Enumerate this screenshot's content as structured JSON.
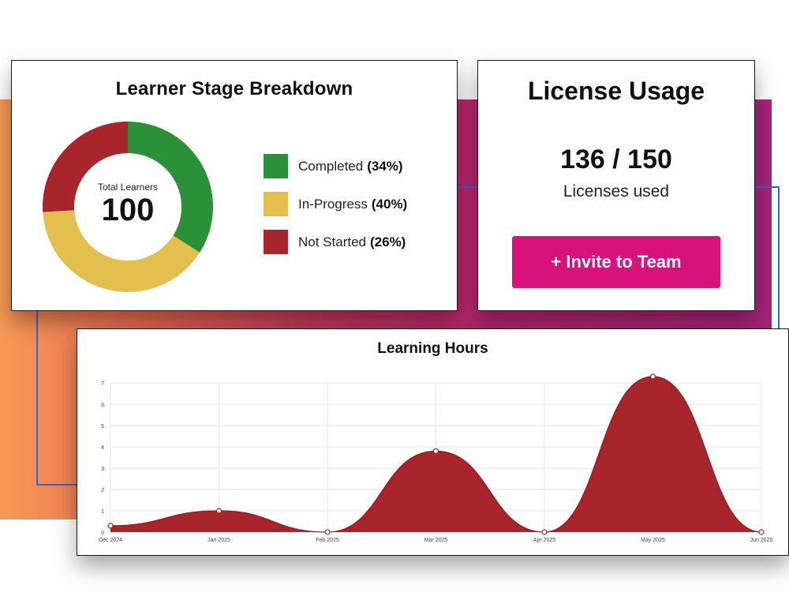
{
  "stage_card": {
    "title": "Learner Stage Breakdown",
    "center_label": "Total Learners",
    "total": "100",
    "items": [
      {
        "label": "Completed",
        "pct": "(34%)",
        "value": 34,
        "color": "#2a9138"
      },
      {
        "label": "In-Progress",
        "pct": "(40%)",
        "value": 40,
        "color": "#e3bf4e"
      },
      {
        "label": "Not Started",
        "pct": "(26%)",
        "value": 26,
        "color": "#a8252b"
      }
    ]
  },
  "license_card": {
    "title": "License Usage",
    "count": "136 / 150",
    "subtitle": "Licenses used",
    "button_label": "+ Invite to Team",
    "button_color": "#d9117a"
  },
  "chart_data": {
    "type": "area",
    "title": "Learning Hours",
    "categories": [
      "Dec 2024",
      "Jan 2025",
      "Feb 2025",
      "Mar 2025",
      "Apr 2025",
      "May 2025",
      "Jun 2025"
    ],
    "values": [
      0.3,
      1.0,
      0.0,
      3.8,
      0.0,
      7.3,
      0.0
    ],
    "ylim": [
      0,
      7
    ],
    "yticks": [
      "0",
      "1",
      "2",
      "3",
      "4",
      "5",
      "6",
      "7"
    ],
    "grid": true,
    "color": "#a8252b"
  }
}
